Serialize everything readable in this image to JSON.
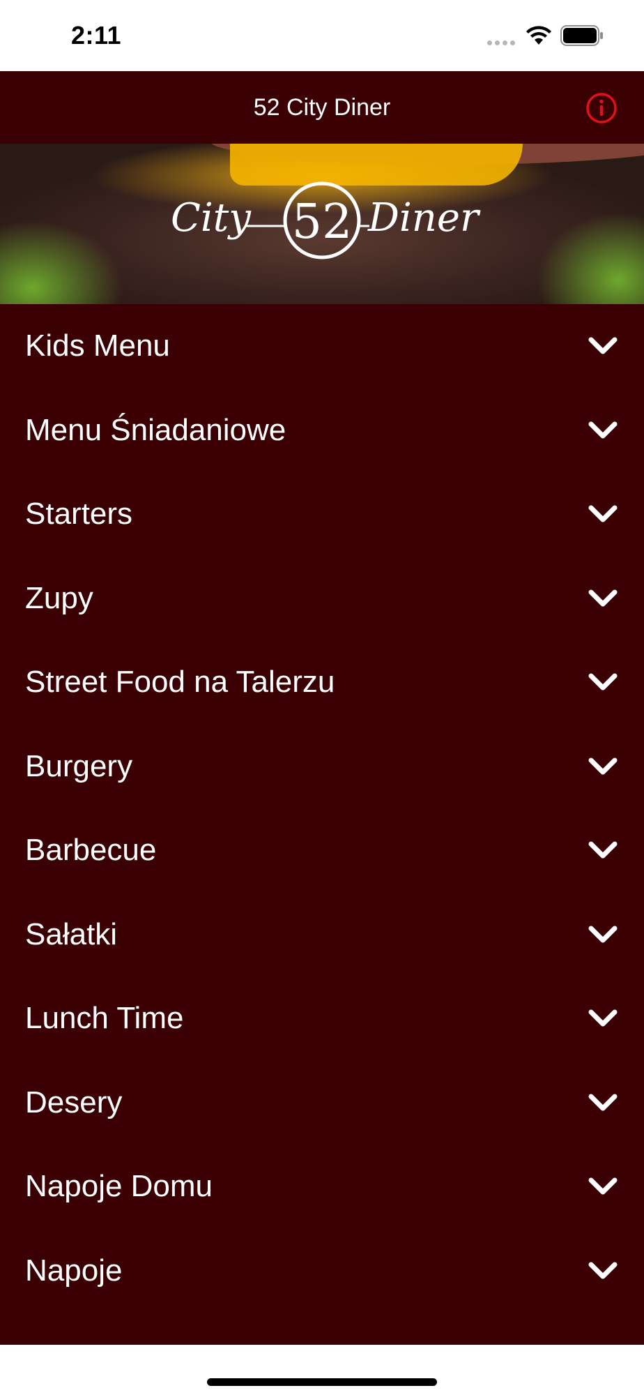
{
  "status_bar": {
    "time": "2:11"
  },
  "nav": {
    "title": "52 City Diner",
    "info_icon": "info-circle-icon",
    "accent": "#e0111b"
  },
  "hero": {
    "logo_text": "City 52 Diner"
  },
  "menu": {
    "items": [
      {
        "label": "Kids Menu"
      },
      {
        "label": "Menu Śniadaniowe"
      },
      {
        "label": "Starters"
      },
      {
        "label": "Zupy"
      },
      {
        "label": "Street Food na Talerzu"
      },
      {
        "label": "Burgery"
      },
      {
        "label": "Barbecue"
      },
      {
        "label": "Sałatki"
      },
      {
        "label": "Lunch Time"
      },
      {
        "label": "Desery"
      },
      {
        "label": "Napoje Domu"
      },
      {
        "label": "Napoje"
      }
    ],
    "chevron_icon": "chevron-down-icon"
  },
  "colors": {
    "background": "#3a0003",
    "text": "#ffffff"
  }
}
